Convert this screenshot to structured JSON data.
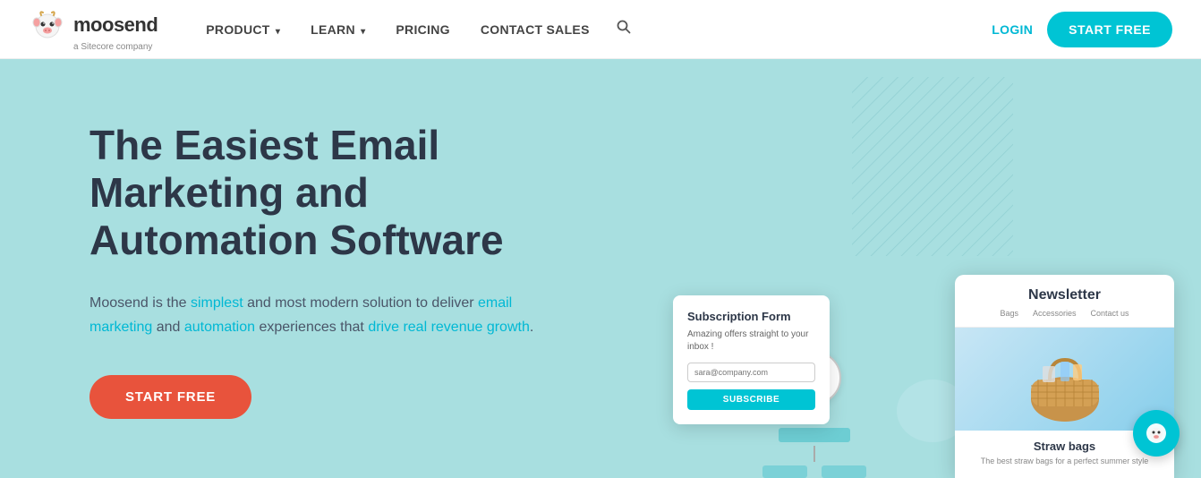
{
  "navbar": {
    "logo_text": "moosend",
    "sitecore_label": "a Sitecore company",
    "nav_items": [
      {
        "label": "PRODUCT",
        "has_arrow": true
      },
      {
        "label": "LEARN",
        "has_arrow": true
      },
      {
        "label": "PRICING",
        "has_arrow": false
      },
      {
        "label": "CONTACT SALES",
        "has_arrow": false
      }
    ],
    "login_label": "LOGIN",
    "start_free_label": "START FREE"
  },
  "hero": {
    "title": "The Easiest Email Marketing and Automation Software",
    "description_parts": {
      "before": "Moosend is the ",
      "highlight1": "simplest",
      "middle1": " and most modern solution to deliver ",
      "highlight2": "email marketing",
      "middle2": " and ",
      "highlight3": "automation",
      "middle3": " experiences that ",
      "highlight4": "drive real revenue growth",
      "after": "."
    },
    "start_free_label": "START FREE"
  },
  "subscription_form": {
    "title": "Subscription Form",
    "description": "Amazing offers straight to your inbox !",
    "input_placeholder": "sara@company.com",
    "button_label": "SUBSCRIBE"
  },
  "newsletter_card": {
    "title": "Newsletter",
    "tabs": [
      "Bags",
      "Accessories",
      "Contact us"
    ],
    "product_name": "Straw bags",
    "product_desc": "The best straw bags for a perfect summer style"
  },
  "chat_bubble": {
    "icon": "chat-icon"
  },
  "colors": {
    "accent": "#00c4d4",
    "hero_bg": "#a8dfe0",
    "cta_red": "#e8533c",
    "text_dark": "#2d3748",
    "text_mid": "#4a5568"
  }
}
